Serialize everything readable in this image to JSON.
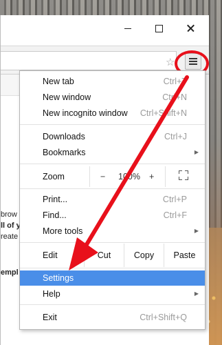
{
  "window": {
    "minimize_label": "minimize",
    "maximize_label": "maximize",
    "close_label": "close"
  },
  "toolbar": {
    "star_icon": "star-icon",
    "menu_icon": "hamburger-menu-icon"
  },
  "page_fragments": [
    "brow",
    "ll of y",
    "reate",
    "empl"
  ],
  "menu": {
    "new_tab": {
      "label": "New tab",
      "shortcut": "Ctrl+T"
    },
    "new_window": {
      "label": "New window",
      "shortcut": "Ctrl+N"
    },
    "new_incognito": {
      "label": "New incognito window",
      "shortcut": "Ctrl+Shift+N"
    },
    "downloads": {
      "label": "Downloads",
      "shortcut": "Ctrl+J"
    },
    "bookmarks": {
      "label": "Bookmarks"
    },
    "zoom": {
      "label": "Zoom",
      "minus": "−",
      "value": "100%",
      "plus": "+"
    },
    "print": {
      "label": "Print...",
      "shortcut": "Ctrl+P"
    },
    "find": {
      "label": "Find...",
      "shortcut": "Ctrl+F"
    },
    "more_tools": {
      "label": "More tools"
    },
    "edit": {
      "label": "Edit",
      "cut": "Cut",
      "copy": "Copy",
      "paste": "Paste"
    },
    "settings": {
      "label": "Settings"
    },
    "help": {
      "label": "Help"
    },
    "exit": {
      "label": "Exit",
      "shortcut": "Ctrl+Shift+Q"
    }
  },
  "colors": {
    "highlight": "#4a8ee8",
    "annotation_red": "#e8101b"
  }
}
